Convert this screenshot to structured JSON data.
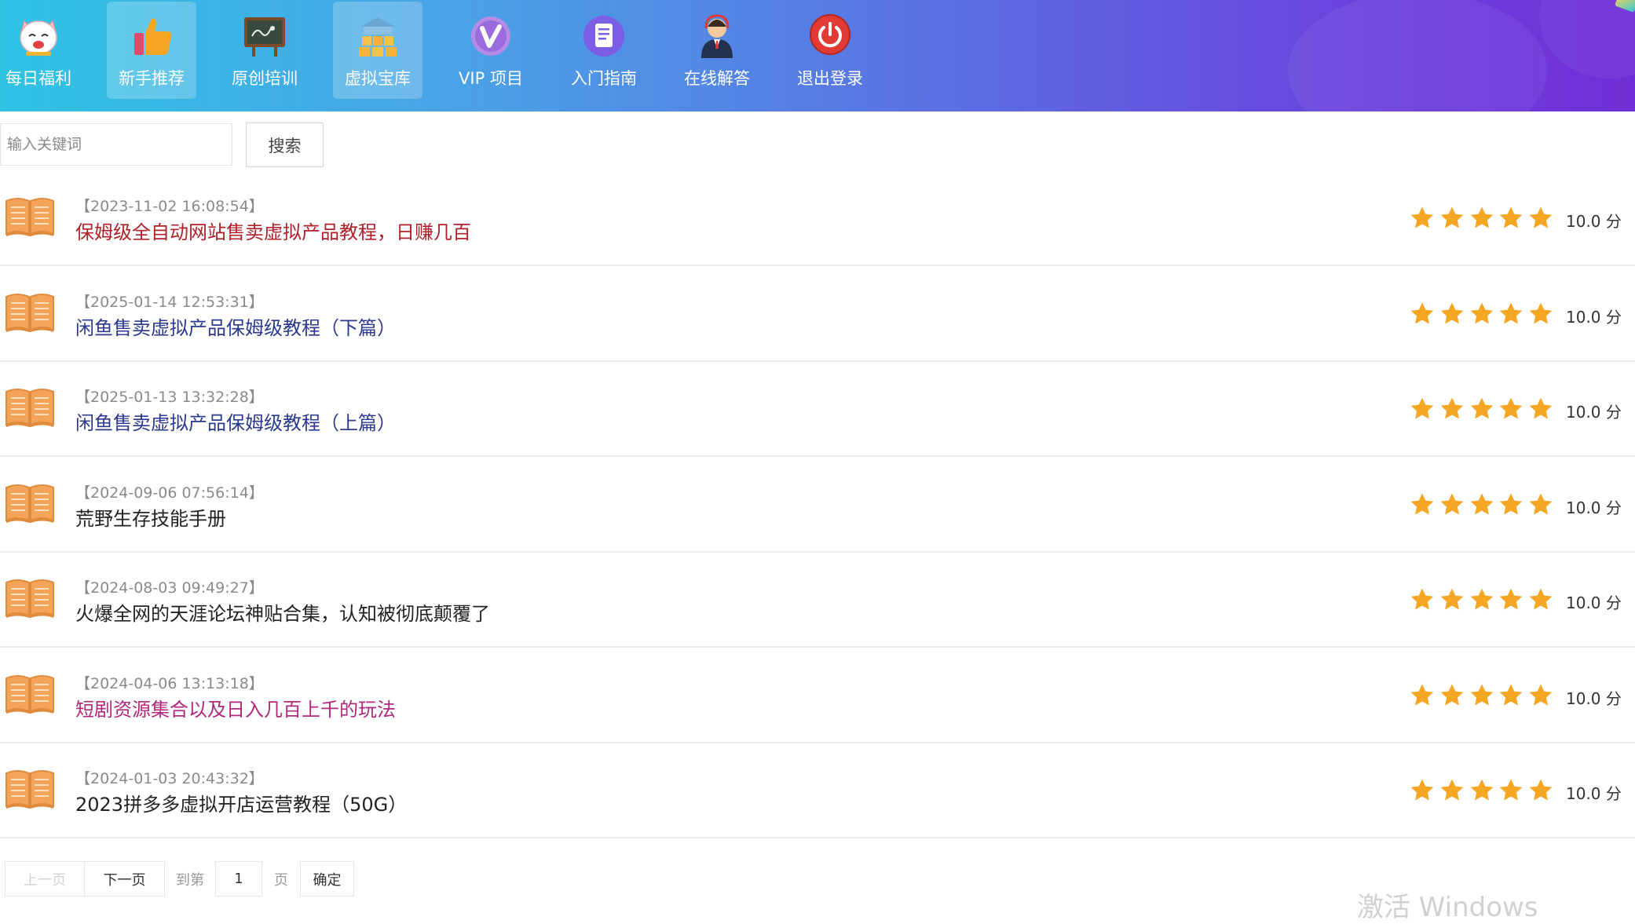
{
  "nav": {
    "items": [
      {
        "label": "每日福利",
        "icon": "lucky-cat-icon",
        "active": false
      },
      {
        "label": "新手推荐",
        "icon": "thumbs-up-icon",
        "active": true
      },
      {
        "label": "原创培训",
        "icon": "blackboard-icon",
        "active": false
      },
      {
        "label": "虚拟宝库",
        "icon": "warehouse-icon",
        "active": true
      },
      {
        "label": "VIP 项目",
        "icon": "vip-icon",
        "active": false
      },
      {
        "label": "入门指南",
        "icon": "document-icon",
        "active": false
      },
      {
        "label": "在线解答",
        "icon": "support-agent-icon",
        "active": false
      },
      {
        "label": "退出登录",
        "icon": "power-icon",
        "active": false
      }
    ]
  },
  "search": {
    "placeholder": "输入关键词",
    "value": "",
    "button_label": "搜索"
  },
  "list": {
    "items": [
      {
        "date": "【2023-11-02 16:08:54】",
        "title": "保姆级全自动网站售卖虚拟产品教程，日赚几百",
        "title_color": "#b0202a",
        "rating": 5,
        "score": "10.0 分"
      },
      {
        "date": "【2025-01-14 12:53:31】",
        "title": "闲鱼售卖虚拟产品保姆级教程（下篇）",
        "title_color": "#2b3a8f",
        "rating": 5,
        "score": "10.0 分"
      },
      {
        "date": "【2025-01-13 13:32:28】",
        "title": "闲鱼售卖虚拟产品保姆级教程（上篇）",
        "title_color": "#2b3a8f",
        "rating": 5,
        "score": "10.0 分"
      },
      {
        "date": "【2024-09-06 07:56:14】",
        "title": "荒野生存技能手册",
        "title_color": "#222222",
        "rating": 5,
        "score": "10.0 分"
      },
      {
        "date": "【2024-08-03 09:49:27】",
        "title": "火爆全网的天涯论坛神贴合集，认知被彻底颠覆了",
        "title_color": "#222222",
        "rating": 5,
        "score": "10.0 分"
      },
      {
        "date": "【2024-04-06 13:13:18】",
        "title": "短剧资源集合以及日入几百上千的玩法",
        "title_color": "#b0287c",
        "rating": 5,
        "score": "10.0 分"
      },
      {
        "date": "【2024-01-03 20:43:32】",
        "title": "2023拼多多虚拟开店运营教程（50G）",
        "title_color": "#222222",
        "rating": 5,
        "score": "10.0 分"
      }
    ]
  },
  "pagination": {
    "prev_label": "上一页",
    "next_label": "下一页",
    "goto_label": "到第",
    "page_value": "1",
    "page_suffix": "页",
    "confirm_label": "确定"
  },
  "watermark": {
    "text": "激活 Windows"
  },
  "colors": {
    "star": "#f5a623",
    "book": "#f4a45a"
  }
}
